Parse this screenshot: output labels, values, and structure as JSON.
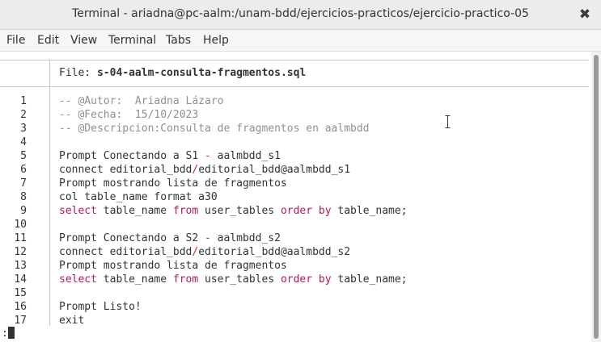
{
  "window": {
    "title": "Terminal - ariadna@pc-aalm:/unam-bdd/ejercicios-practicos/ejercicio-practico-05",
    "close_glyph": "✖"
  },
  "menu": {
    "items": [
      "File",
      "Edit",
      "View",
      "Terminal",
      "Tabs",
      "Help"
    ]
  },
  "file": {
    "label": "File: ",
    "name": "s-04-aalm-consulta-fragmentos.sql"
  },
  "lines": [
    {
      "n": "1",
      "parts": [
        [
          "comment",
          "-- @Autor:  Ariadna Lázaro"
        ]
      ]
    },
    {
      "n": "2",
      "parts": [
        [
          "comment",
          "-- @Fecha:  15/10/2023"
        ]
      ]
    },
    {
      "n": "3",
      "parts": [
        [
          "comment",
          "-- @Descripcion:Consulta de fragmentos en aalmbdd"
        ]
      ]
    },
    {
      "n": "4",
      "parts": []
    },
    {
      "n": "5",
      "parts": [
        [
          "plain",
          "Prompt Conectando a S1 "
        ],
        [
          "sep",
          "-"
        ],
        [
          "plain",
          " aalmbdd_s1"
        ]
      ]
    },
    {
      "n": "6",
      "parts": [
        [
          "plain",
          "connect editorial_bdd"
        ],
        [
          "sep",
          "/"
        ],
        [
          "plain",
          "editorial_bdd@aalmbdd_s1"
        ]
      ]
    },
    {
      "n": "7",
      "parts": [
        [
          "plain",
          "Prompt mostrando lista de fragmentos"
        ]
      ]
    },
    {
      "n": "8",
      "parts": [
        [
          "plain",
          "col table_name format a30"
        ]
      ]
    },
    {
      "n": "9",
      "parts": [
        [
          "keyword",
          "select"
        ],
        [
          "plain",
          " table_name "
        ],
        [
          "keyword",
          "from"
        ],
        [
          "plain",
          " user_tables "
        ],
        [
          "keyword",
          "order by"
        ],
        [
          "plain",
          " table_name;"
        ]
      ]
    },
    {
      "n": "10",
      "parts": []
    },
    {
      "n": "11",
      "parts": [
        [
          "plain",
          "Prompt Conectando a S2 "
        ],
        [
          "sep",
          "-"
        ],
        [
          "plain",
          " aalmbdd_s2"
        ]
      ]
    },
    {
      "n": "12",
      "parts": [
        [
          "plain",
          "connect editorial_bdd"
        ],
        [
          "sep",
          "/"
        ],
        [
          "plain",
          "editorial_bdd@aalmbdd_s2"
        ]
      ]
    },
    {
      "n": "13",
      "parts": [
        [
          "plain",
          "Prompt mostrando lista de fragmentos"
        ]
      ]
    },
    {
      "n": "14",
      "parts": [
        [
          "keyword",
          "select"
        ],
        [
          "plain",
          " table_name "
        ],
        [
          "keyword",
          "from"
        ],
        [
          "plain",
          " user_tables "
        ],
        [
          "keyword",
          "order by"
        ],
        [
          "plain",
          " table_name;"
        ]
      ]
    },
    {
      "n": "15",
      "parts": []
    },
    {
      "n": "16",
      "parts": [
        [
          "plain",
          "Prompt Listo!"
        ]
      ]
    },
    {
      "n": "17",
      "parts": [
        [
          "plain",
          "exit"
        ]
      ]
    }
  ],
  "pager": {
    "prompt": ":"
  },
  "colors": {
    "comment": "#8f8f8f",
    "keyword": "#b5185f",
    "operator": "#c4302b",
    "text": "#2e3436"
  }
}
